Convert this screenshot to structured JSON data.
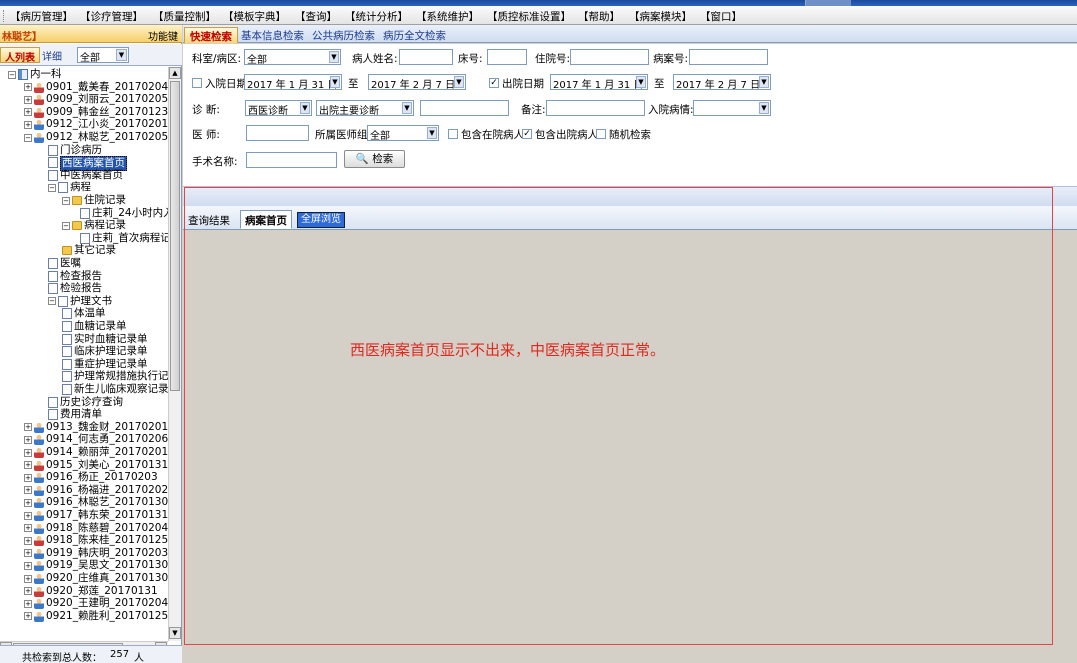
{
  "menu": [
    "【病历管理】",
    "【诊疗管理】",
    "【质量控制】",
    "【模板字典】",
    "【查询】",
    "【统计分析】",
    "【系统维护】",
    "【质控标准设置】",
    "【帮助】",
    "【病案模块】",
    "【窗口】"
  ],
  "left": {
    "user": "林聪艺】",
    "function_key": "功能键",
    "tab_list": "人列表",
    "tab_detail": "详细",
    "filter": "全部"
  },
  "tree": [
    {
      "label": "内一科",
      "level": 0,
      "icon": "book",
      "pm": "-"
    },
    {
      "label": "0901_戴美春_20170204",
      "level": 1,
      "icon": "personf",
      "pm": "+"
    },
    {
      "label": "0909_刘丽云_20170205",
      "level": 1,
      "icon": "personf",
      "pm": "+"
    },
    {
      "label": "0909_韩金丝_20170123",
      "level": 1,
      "icon": "personf",
      "pm": "+"
    },
    {
      "label": "0912_江小炎_20170201",
      "level": 1,
      "icon": "person",
      "pm": "+"
    },
    {
      "label": "0912_林聪艺_20170205",
      "level": 1,
      "icon": "person",
      "pm": "-"
    },
    {
      "label": "门诊病历",
      "level": 2,
      "icon": "doc",
      "pm": ""
    },
    {
      "label": "西医病案首页",
      "level": 2,
      "icon": "doc",
      "pm": "",
      "selected": true
    },
    {
      "label": "中医病案首页",
      "level": 2,
      "icon": "doc",
      "pm": ""
    },
    {
      "label": "病程",
      "level": 2,
      "icon": "doc",
      "pm": "-"
    },
    {
      "label": "住院记录",
      "level": 3,
      "icon": "folder",
      "pm": "-"
    },
    {
      "label": "庄莉_24小时内入",
      "level": 4,
      "icon": "doc",
      "pm": ""
    },
    {
      "label": "病程记录",
      "level": 3,
      "icon": "folder",
      "pm": "-"
    },
    {
      "label": "庄莉_首次病程记",
      "level": 4,
      "icon": "doc",
      "pm": ""
    },
    {
      "label": "其它记录",
      "level": 3,
      "icon": "folder",
      "pm": ""
    },
    {
      "label": "医嘱",
      "level": 2,
      "icon": "doc",
      "pm": ""
    },
    {
      "label": "检查报告",
      "level": 2,
      "icon": "doc",
      "pm": ""
    },
    {
      "label": "检验报告",
      "level": 2,
      "icon": "doc",
      "pm": ""
    },
    {
      "label": "护理文书",
      "level": 2,
      "icon": "doc",
      "pm": "-"
    },
    {
      "label": "体温单",
      "level": 3,
      "icon": "doc",
      "pm": ""
    },
    {
      "label": "血糖记录单",
      "level": 3,
      "icon": "doc",
      "pm": ""
    },
    {
      "label": "实时血糖记录单",
      "level": 3,
      "icon": "doc",
      "pm": ""
    },
    {
      "label": "临床护理记录单",
      "level": 3,
      "icon": "doc",
      "pm": ""
    },
    {
      "label": "重症护理记录单",
      "level": 3,
      "icon": "doc",
      "pm": ""
    },
    {
      "label": "护理常规措施执行记",
      "level": 3,
      "icon": "doc",
      "pm": ""
    },
    {
      "label": "新生儿临床观察记录",
      "level": 3,
      "icon": "doc",
      "pm": ""
    },
    {
      "label": "历史诊疗查询",
      "level": 2,
      "icon": "doc",
      "pm": ""
    },
    {
      "label": "费用清单",
      "level": 2,
      "icon": "doc",
      "pm": ""
    },
    {
      "label": "0913_魏金财_20170201",
      "level": 1,
      "icon": "person",
      "pm": "+"
    },
    {
      "label": "0914_何志勇_20170206",
      "level": 1,
      "icon": "person",
      "pm": "+"
    },
    {
      "label": "0914_赖丽萍_20170201",
      "level": 1,
      "icon": "personf",
      "pm": "+"
    },
    {
      "label": "0915_刘美心_20170131",
      "level": 1,
      "icon": "personf",
      "pm": "+"
    },
    {
      "label": "0916_杨正_20170203",
      "level": 1,
      "icon": "person",
      "pm": "+"
    },
    {
      "label": "0916_杨福进_20170202",
      "level": 1,
      "icon": "person",
      "pm": "+"
    },
    {
      "label": "0916_林聪艺_20170130",
      "level": 1,
      "icon": "person",
      "pm": "+"
    },
    {
      "label": "0917_韩东荣_20170131",
      "level": 1,
      "icon": "person",
      "pm": "+"
    },
    {
      "label": "0918_陈慈碧_20170204",
      "level": 1,
      "icon": "person",
      "pm": "+"
    },
    {
      "label": "0918_陈来桂_20170125",
      "level": 1,
      "icon": "personf",
      "pm": "+"
    },
    {
      "label": "0919_韩庆明_20170203",
      "level": 1,
      "icon": "person",
      "pm": "+"
    },
    {
      "label": "0919_吴思文_20170130",
      "level": 1,
      "icon": "person",
      "pm": "+"
    },
    {
      "label": "0920_庄维真_20170130",
      "level": 1,
      "icon": "person",
      "pm": "+"
    },
    {
      "label": "0920_郑莲_20170131",
      "level": 1,
      "icon": "personf",
      "pm": "+"
    },
    {
      "label": "0920_王建明_20170204",
      "level": 1,
      "icon": "person",
      "pm": "+"
    },
    {
      "label": "0921_赖胜利_20170125",
      "level": 1,
      "icon": "person",
      "pm": "+"
    }
  ],
  "status": {
    "label": "共检索到总人数：",
    "count": "257",
    "unit": "人"
  },
  "search_tabs": [
    "快速检索",
    "基本信息检索",
    "公共病历检索",
    "病历全文检索"
  ],
  "form": {
    "dept_label": "科室/病区:",
    "dept_value": "全部",
    "name_label": "病人姓名:",
    "name_value": "",
    "bed_label": "床号:",
    "bed_value": "",
    "inpatient_no_label": "住院号:",
    "inpatient_no_value": "",
    "record_no_label": "病案号:",
    "record_no_value": "",
    "admit_date_label": "入院日期",
    "admit_date_checked": false,
    "admit_from": "2017 年 1 月 31 日",
    "to_label": "至",
    "admit_to": "2017 年 2 月 7 日",
    "discharge_date_label": "出院日期",
    "discharge_date_checked": true,
    "discharge_from": "2017 年 1 月 31 日",
    "discharge_to": "2017 年 2 月 7 日",
    "diagnosis_label": "诊    断:",
    "diagnosis_type": "西医诊断",
    "diagnosis_kind": "出院主要诊断",
    "diagnosis_value": "",
    "remark_label": "备注:",
    "remark_value": "",
    "condition_label": "入院病情:",
    "condition_value": "",
    "doctor_label": "医    师:",
    "doctor_value": "",
    "group_label": "所属医师组",
    "group_value": "全部",
    "include_in_label": "包含在院病人",
    "include_in_checked": false,
    "include_out_label": "包含出院病人",
    "include_out_checked": true,
    "random_label": "随机检索",
    "random_checked": false,
    "surgery_label": "手术名称:",
    "surgery_value": "",
    "search_button": "检索"
  },
  "results": {
    "label": "查询结果",
    "tab_active": "病案首页",
    "tab_fullscreen": "全屏浏览",
    "note": "西医病案首页显示不出来，中医病案首页正常。"
  },
  "colors": {
    "note": "#e0281e",
    "box": "#e0454a",
    "accent": "#2f6bd8"
  }
}
